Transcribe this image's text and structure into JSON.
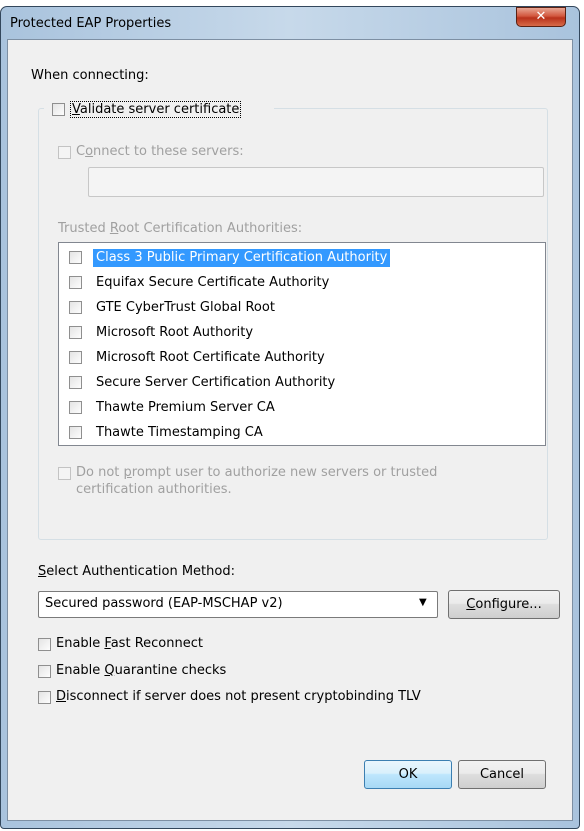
{
  "window": {
    "title": "Protected EAP Properties",
    "close_glyph": "✕"
  },
  "when_connecting": {
    "label": "When connecting:",
    "validate_cert": {
      "label_mnemonic": "V",
      "label_rest": "alidate server certificate",
      "checked": false
    },
    "connect_servers": {
      "label_pre": "C",
      "label_mnemonic": "o",
      "label_rest": "nnect to these servers:",
      "checked": false,
      "enabled": false,
      "value": ""
    },
    "trusted_roots_label_pre": "Trusted ",
    "trusted_roots_mnemonic": "R",
    "trusted_roots_label_rest": "oot Certification Authorities:",
    "authorities": [
      {
        "name": "Class 3 Public Primary Certification Authority",
        "checked": false,
        "selected": true
      },
      {
        "name": "Equifax Secure Certificate Authority",
        "checked": false,
        "selected": false
      },
      {
        "name": "GTE CyberTrust Global Root",
        "checked": false,
        "selected": false
      },
      {
        "name": "Microsoft Root Authority",
        "checked": false,
        "selected": false
      },
      {
        "name": "Microsoft Root Certificate Authority",
        "checked": false,
        "selected": false
      },
      {
        "name": "Secure Server Certification Authority",
        "checked": false,
        "selected": false
      },
      {
        "name": "Thawte Premium Server CA",
        "checked": false,
        "selected": false
      },
      {
        "name": "Thawte Timestamping CA",
        "checked": false,
        "selected": false
      }
    ],
    "no_prompt": {
      "line1_pre": "Do not ",
      "line1_mnemonic": "p",
      "line1_rest": "rompt user to authorize new servers or trusted",
      "line2": "certification authorities.",
      "checked": false,
      "enabled": false
    }
  },
  "auth": {
    "label_pre": "",
    "label_mnemonic": "S",
    "label_rest": "elect Authentication Method:",
    "selected_method": "Secured password (EAP-MSCHAP v2)",
    "combo_arrow": "▼",
    "configure_mnemonic": "C",
    "configure_rest": "onfigure..."
  },
  "options": {
    "fast_reconnect": {
      "pre": "Enable ",
      "mnemonic": "F",
      "rest": "ast Reconnect",
      "checked": false
    },
    "quarantine": {
      "pre": "Enable ",
      "mnemonic": "Q",
      "rest": "uarantine checks",
      "checked": false
    },
    "disconnect": {
      "pre": "",
      "mnemonic": "D",
      "rest": "isconnect if server does not present cryptobinding TLV",
      "checked": false
    }
  },
  "buttons": {
    "ok": "OK",
    "cancel": "Cancel"
  },
  "colors": {
    "selection": "#3399ff",
    "window_frame": "#a9c3dd",
    "close_button": "#c8452a"
  }
}
